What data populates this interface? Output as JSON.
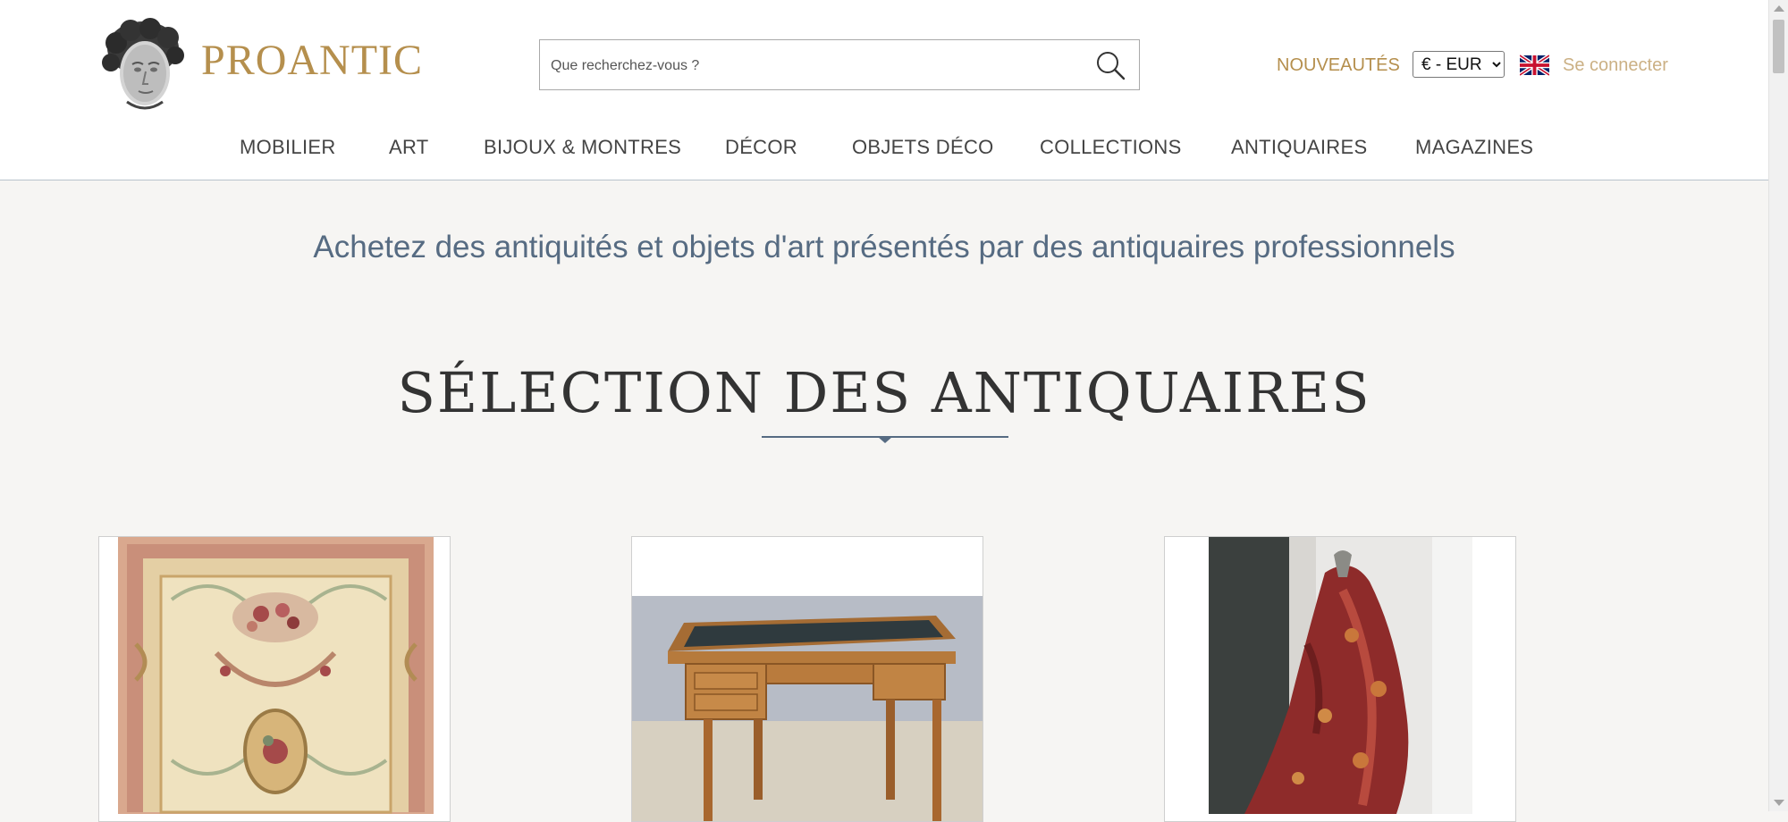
{
  "header": {
    "logo_text": "PROANTIC",
    "search": {
      "placeholder": "Que recherchez-vous ?",
      "value": ""
    },
    "nouveautes_label": "NOUVEAUTÉS",
    "currency": {
      "selected": "€ - EUR"
    },
    "language_flag": "uk-flag-icon",
    "login_label": "Se connecter"
  },
  "nav": {
    "items": [
      {
        "label": "MOBILIER"
      },
      {
        "label": "ART"
      },
      {
        "label": "BIJOUX & MONTRES"
      },
      {
        "label": "DÉCOR"
      },
      {
        "label": "OBJETS DÉCO"
      },
      {
        "label": "COLLECTIONS"
      },
      {
        "label": "ANTIQUAIRES"
      },
      {
        "label": "MAGAZINES"
      }
    ]
  },
  "main": {
    "tagline": "Achetez des antiquités et objets d'art présentés par des antiquaires professionnels",
    "section_title": "SÉLECTION DES ANTIQUAIRES",
    "products": [
      {
        "image": "aubusson-rug-image"
      },
      {
        "image": "writing-desk-image"
      },
      {
        "image": "paisley-shawl-image"
      }
    ]
  },
  "colors": {
    "gold": "#b58f4d",
    "light_gold": "#cbb084",
    "slate_blue": "#566b82",
    "background": "#f6f5f3"
  }
}
